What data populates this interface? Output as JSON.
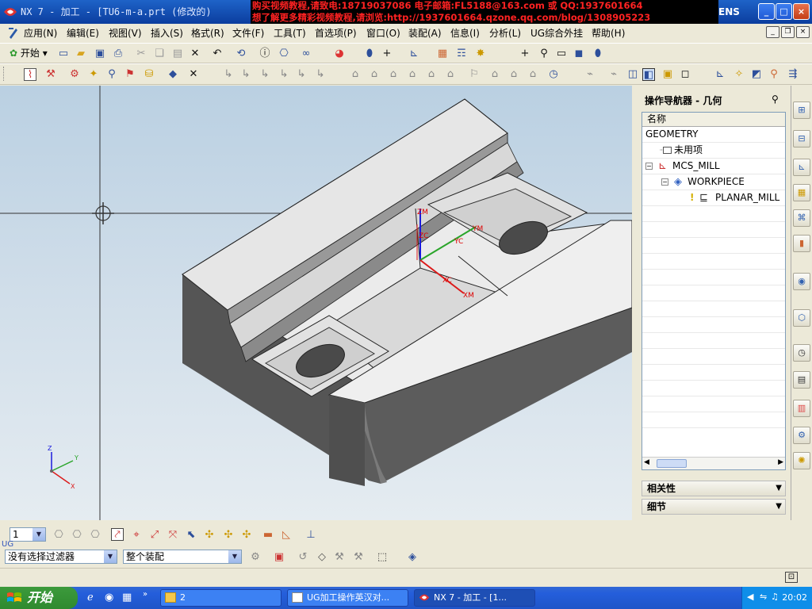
{
  "window": {
    "title": "NX 7 - 加工 - [TU6-m-a.prt (修改的)",
    "vendor": "ENS",
    "controls": {
      "minimize": "_",
      "maximize": "□",
      "close": "×"
    }
  },
  "ad_banner": {
    "line1": "购买视频教程,请致电:18719037086 电子邮箱:FL5188@163.com 或 QQ:1937601664",
    "line2": "想了解更多精彩视频教程,请浏览:http://1937601664.qzone.qq.com/blog/1308905223"
  },
  "menu": {
    "items": [
      "应用(N)",
      "编辑(E)",
      "视图(V)",
      "插入(S)",
      "格式(R)",
      "文件(F)",
      "工具(T)",
      "首选项(P)",
      "窗口(O)",
      "装配(A)",
      "信息(I)",
      "分析(L)",
      "UG综合外挂",
      "帮助(H)"
    ]
  },
  "toolbar1": {
    "start_label": "开始"
  },
  "graphics": {
    "wcs_labels": {
      "zm": "ZM",
      "zc": "ZC",
      "ym": "YM",
      "yc": "YC",
      "xc": "XC",
      "xm": "XM"
    },
    "triad_labels": {
      "z": "Z",
      "y": "Y",
      "x": "X"
    }
  },
  "navigator": {
    "title": "操作导航器 - 几何",
    "column_name": "名称",
    "rows": [
      {
        "label": "GEOMETRY",
        "icon": "none"
      },
      {
        "label": "未用项",
        "icon": "unused-folder-icon"
      },
      {
        "label": "MCS_MILL",
        "icon": "mcs-icon"
      },
      {
        "label": "WORKPIECE",
        "icon": "workpiece-icon"
      },
      {
        "label": "PLANAR_MILL",
        "icon": "planar-mill-icon"
      }
    ],
    "panels": [
      "相关性",
      "细节"
    ]
  },
  "bottom": {
    "layer_value": "1",
    "filter_value": "没有选择过滤器",
    "scope_value": "整个装配",
    "cue_prefix": "UG"
  },
  "taskbar": {
    "start_label": "开始",
    "tasks": [
      "2",
      "UG加工操作英汉对...",
      "NX 7 - 加工 - [1..."
    ],
    "clock": "20:02"
  },
  "colors": {
    "title_bar": "#1e63c8",
    "ad_text": "#ff2222",
    "part_top": "#ebebeb",
    "part_side": "#5a5a5a",
    "taskbar": "#245edb"
  }
}
